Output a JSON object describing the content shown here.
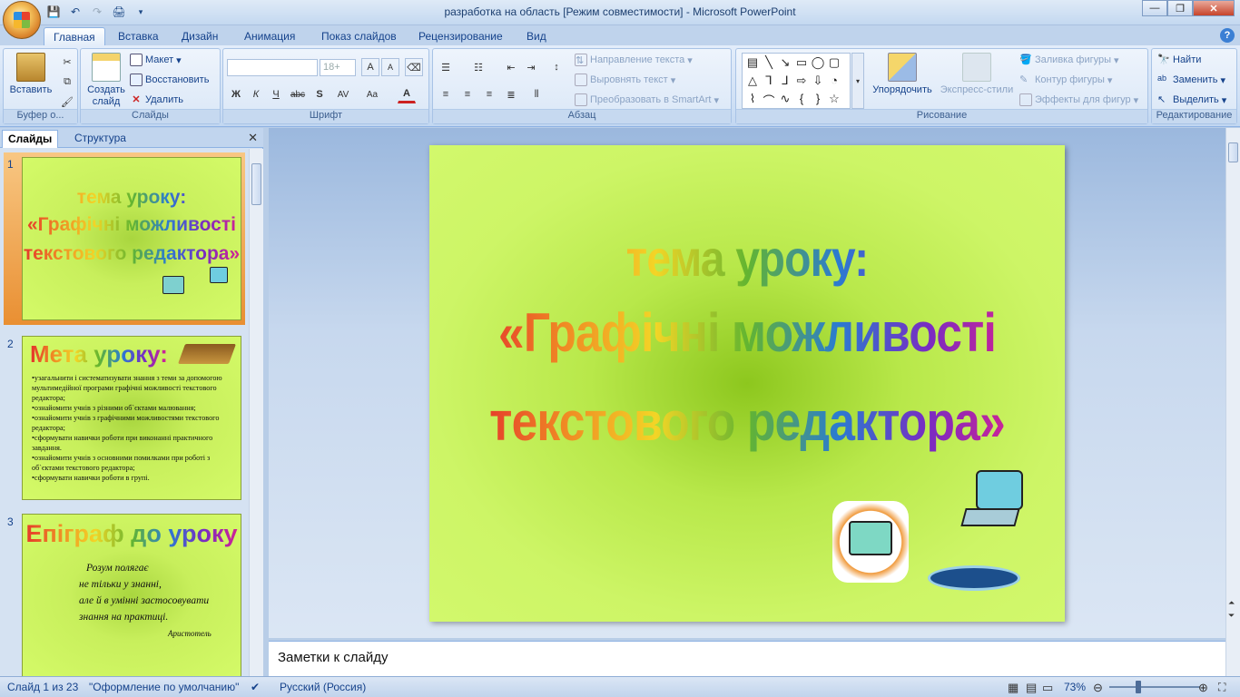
{
  "window": {
    "title": "разработка на область [Режим совместимости] - Microsoft PowerPoint"
  },
  "tabs": [
    "Главная",
    "Вставка",
    "Дизайн",
    "Анимация",
    "Показ слайдов",
    "Рецензирование",
    "Вид"
  ],
  "ribbon": {
    "clipboard": {
      "paste": "Вставить",
      "label": "Буфер о..."
    },
    "slides": {
      "new_slide": "Создать слайд",
      "layout": "Макет",
      "reset": "Восстановить",
      "delete": "Удалить",
      "label": "Слайды"
    },
    "font": {
      "size": "18+",
      "label": "Шрифт"
    },
    "paragraph": {
      "text_direction": "Направление текста",
      "align_text": "Выровнять текст",
      "smartart": "Преобразовать в SmartArt",
      "label": "Абзац"
    },
    "drawing": {
      "arrange": "Упорядочить",
      "quick_styles": "Экспресс-стили",
      "fill": "Заливка фигуры",
      "outline": "Контур фигуры",
      "effects": "Эффекты для фигур",
      "label": "Рисование"
    },
    "editing": {
      "find": "Найти",
      "replace": "Заменить",
      "select": "Выделить",
      "label": "Редактирование"
    }
  },
  "panel": {
    "tab_slides": "Слайды",
    "tab_outline": "Структура"
  },
  "thumbnails": [
    {
      "num": "1",
      "title": "тема уроку:",
      "line2": "«Графічні можливості",
      "line3": "текстового редактора»"
    },
    {
      "num": "2",
      "title": "Мета уроку:",
      "bullets": [
        "•узагальнити і систематизувати знання з теми за допомогою мультимедійної програми графічні можливості текстового редактора;",
        "•ознайомити учнів з різними об`єктами малювання;",
        "•ознайомити учнів з графічними можливостями текстового редактора;",
        "•сформувати навички роботи при виконанні практичного завдання.",
        "•ознайомити учнів з основними помилками при роботі з об`єктами текстового редактора;",
        "•сформувати навички роботи в групі."
      ]
    },
    {
      "num": "3",
      "title": "Епіграф до уроку",
      "quote": [
        "Розум полягає",
        "не тільки у знанні,",
        "але й в умінні застосовувати",
        "знання на практиці."
      ],
      "author": "Аристотель"
    }
  ],
  "slide": {
    "line1": "тема уроку:",
    "line2": "«Графічні можливості",
    "line3": "текстового редактора»"
  },
  "notes": {
    "placeholder": "Заметки к слайду"
  },
  "status": {
    "slide_info": "Слайд 1 из 23",
    "theme": "\"Оформление по умолчанию\"",
    "language": "Русский (Россия)",
    "zoom": "73%"
  }
}
